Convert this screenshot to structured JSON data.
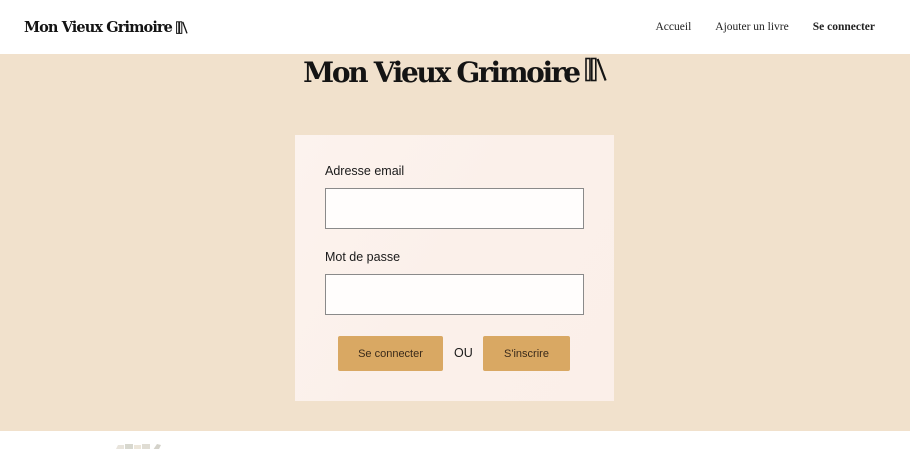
{
  "header": {
    "logo_text": "Mon Vieux Grimoire",
    "nav": {
      "home": "Accueil",
      "add_book": "Ajouter un livre",
      "login": "Se connecter"
    }
  },
  "hero": {
    "logo_text": "Mon Vieux Grimoire"
  },
  "login_form": {
    "email_label": "Adresse email",
    "email_value": "",
    "password_label": "Mot de passe",
    "password_value": "",
    "login_button": "Se connecter",
    "separator": "OU",
    "signup_button": "S'inscrire"
  },
  "colors": {
    "background": "#f1e1cc",
    "card": "#fbf0ea",
    "button": "#d9a863"
  },
  "icons": {
    "logo": "books-icon"
  }
}
